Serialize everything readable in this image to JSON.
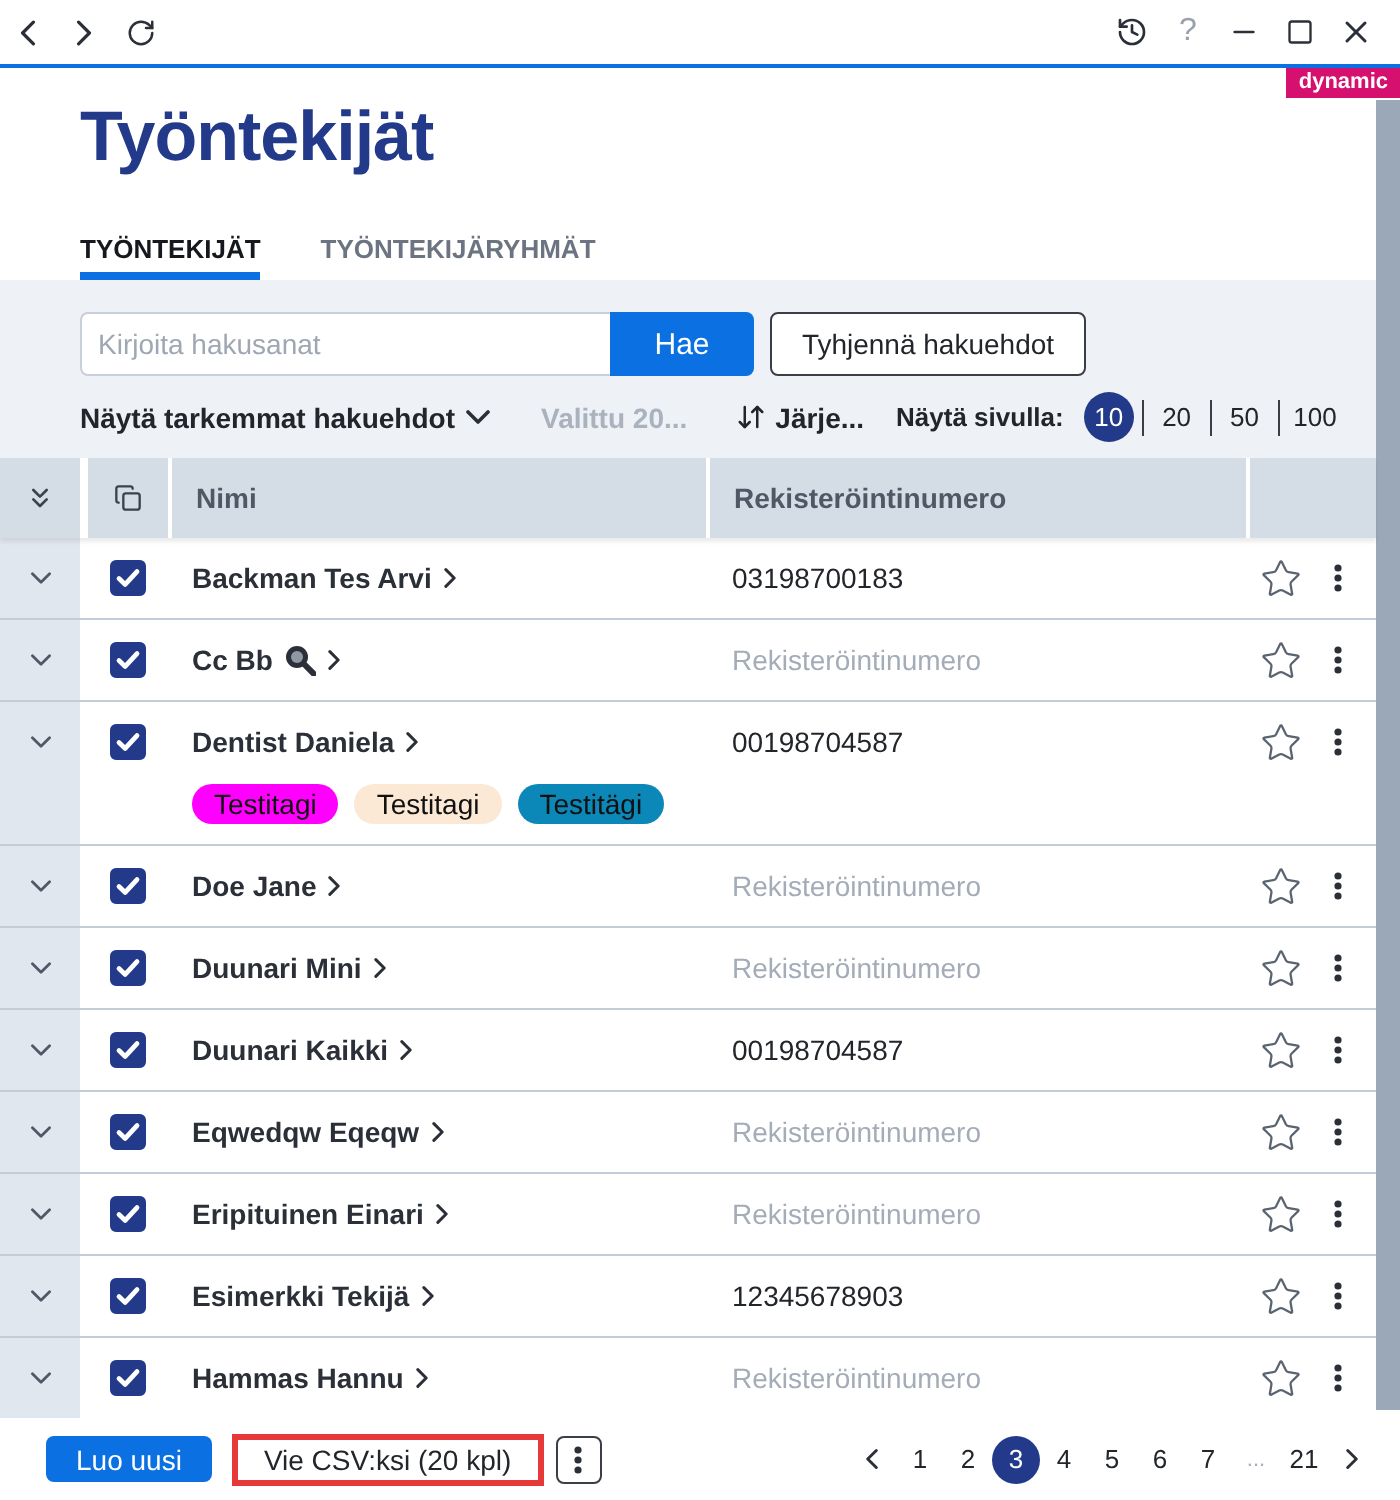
{
  "window": {
    "help": {
      "label": "?",
      "disabled": true
    }
  },
  "badge": "dynamic",
  "title": "Työntekijät",
  "tabs": [
    {
      "label": "TYÖNTEKIJÄT",
      "selected": true
    },
    {
      "label": "TYÖNTEKIJÄRYHMÄT",
      "selected": false
    }
  ],
  "search": {
    "placeholder": "Kirjoita hakusanat",
    "submit": "Hae",
    "clear": "Tyhjennä hakuehdot"
  },
  "toolbar": {
    "advanced": "Näytä tarkemmat hakuehdot",
    "selection": {
      "label": "Valittu 20...",
      "disabled": true
    },
    "sort": "Järje...",
    "page_size_label": "Näytä sivulla:",
    "page_sizes": [
      {
        "label": "10",
        "selected": true
      },
      {
        "label": "20",
        "selected": false
      },
      {
        "label": "50",
        "selected": false
      },
      {
        "label": "100",
        "selected": false
      }
    ]
  },
  "table": {
    "columns": [
      "Nimi",
      "Rekisteröintinumero"
    ],
    "rows": [
      {
        "name": "Backman Tes Arvi",
        "flagged": false,
        "checked": true,
        "favorite": false,
        "registration": {
          "text": "03198700183",
          "empty": false
        }
      },
      {
        "name": "Cc Bb",
        "flagged": true,
        "checked": true,
        "favorite": false,
        "registration": {
          "text": "Rekisteröintinumero",
          "empty": true
        }
      },
      {
        "name": "Dentist Daniela",
        "flagged": false,
        "checked": true,
        "favorite": false,
        "registration": {
          "text": "00198704587",
          "empty": false
        },
        "tags": [
          {
            "label": "Testitagi",
            "color": "#ff00ff"
          },
          {
            "label": "Testitagi",
            "color": "#fbe9d6"
          },
          {
            "label": "Testitägi",
            "color": "#0b87b8"
          }
        ]
      },
      {
        "name": "Doe Jane",
        "flagged": false,
        "checked": true,
        "favorite": false,
        "registration": {
          "text": "Rekisteröintinumero",
          "empty": true
        }
      },
      {
        "name": "Duunari Mini",
        "flagged": false,
        "checked": true,
        "favorite": false,
        "registration": {
          "text": "Rekisteröintinumero",
          "empty": true
        }
      },
      {
        "name": "Duunari Kaikki",
        "flagged": false,
        "checked": true,
        "favorite": false,
        "registration": {
          "text": "00198704587",
          "empty": false
        }
      },
      {
        "name": "Eqwedqw Eqeqw",
        "flagged": false,
        "checked": true,
        "favorite": false,
        "registration": {
          "text": "Rekisteröintinumero",
          "empty": true
        }
      },
      {
        "name": "Eripituinen Einari",
        "flagged": false,
        "checked": true,
        "favorite": false,
        "registration": {
          "text": "Rekisteröintinumero",
          "empty": true
        }
      },
      {
        "name": "Esimerkki Tekijä",
        "flagged": false,
        "checked": true,
        "favorite": false,
        "registration": {
          "text": "12345678903",
          "empty": false
        }
      },
      {
        "name": "Hammas Hannu",
        "flagged": false,
        "checked": true,
        "favorite": false,
        "registration": {
          "text": "Rekisteröintinumero",
          "empty": true
        }
      }
    ]
  },
  "footer": {
    "create": "Luo uusi",
    "export": {
      "label": "Vie CSV:ksi (20 kpl)",
      "highlighted": true
    },
    "pagination": [
      {
        "label": "1",
        "kind": "page",
        "selected": false
      },
      {
        "label": "2",
        "kind": "page",
        "selected": false
      },
      {
        "label": "3",
        "kind": "page",
        "selected": true
      },
      {
        "label": "4",
        "kind": "page",
        "selected": false
      },
      {
        "label": "5",
        "kind": "page",
        "selected": false
      },
      {
        "label": "6",
        "kind": "page",
        "selected": false
      },
      {
        "label": "7",
        "kind": "page",
        "selected": false
      },
      {
        "label": "...",
        "kind": "ellipsis",
        "selected": false
      },
      {
        "label": "21",
        "kind": "page",
        "selected": false
      }
    ]
  }
}
